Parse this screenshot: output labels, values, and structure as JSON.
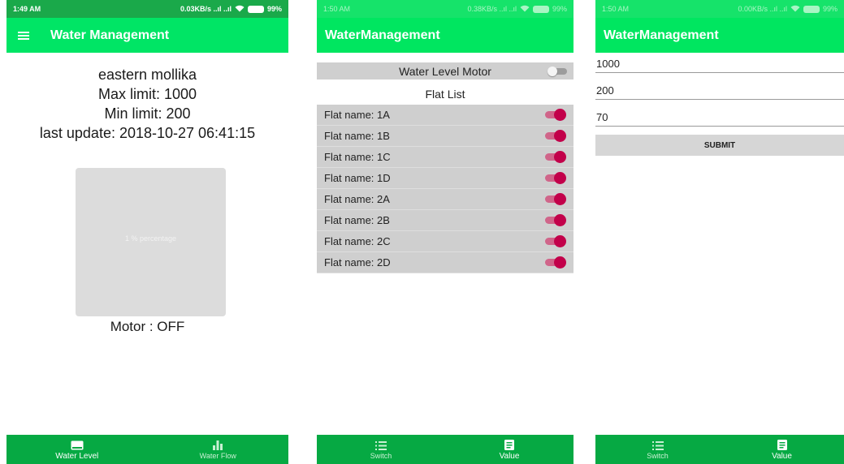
{
  "colors": {
    "status_bar_dark": "#1aa94a",
    "status_bar_light": "#16e36a",
    "app_bar": "#00e660",
    "bottom_nav": "#06a943",
    "toggle_on": "#c2004a",
    "row_gray": "#cfcfcf",
    "water": "#6ee3ee"
  },
  "screen1": {
    "status": {
      "time": "1:49 AM",
      "network": "0.03KB/s ..ıl ..ıl",
      "wifi_icon": "wifi-icon",
      "battery": "99%"
    },
    "app_bar": {
      "menu_icon": "hamburger-menu-icon",
      "title": "Water Management"
    },
    "tank_name": "eastern mollika",
    "max_limit": "Max limit: 1000",
    "min_limit": "Min limit: 200",
    "last_update": "last update: 2018-10-27 06:41:15",
    "tank_gauge": {
      "label": "1 % percentage",
      "level_percent": 1
    },
    "motor_status": "Motor :  OFF",
    "nav": [
      {
        "icon": "water-level-icon",
        "label": "Water Level",
        "active": true
      },
      {
        "icon": "bar-chart-icon",
        "label": "Water Flow",
        "active": false
      }
    ]
  },
  "screen2": {
    "status": {
      "time": "1:50 AM",
      "network": "0.38KB/s ..ıl ..ıl",
      "wifi_icon": "wifi-icon",
      "battery": "99%"
    },
    "app_bar": {
      "title": "WaterManagement"
    },
    "motor_toggle": {
      "label": "Water Level Motor",
      "on": false
    },
    "flat_list_title": "Flat List",
    "flats": [
      {
        "label": "Flat name: 1A",
        "on": true
      },
      {
        "label": "Flat name: 1B",
        "on": true
      },
      {
        "label": "Flat name: 1C",
        "on": true
      },
      {
        "label": "Flat name: 1D",
        "on": true
      },
      {
        "label": "Flat name: 2A",
        "on": true
      },
      {
        "label": "Flat name: 2B",
        "on": true
      },
      {
        "label": "Flat name: 2C",
        "on": true
      },
      {
        "label": "Flat name: 2D",
        "on": true
      }
    ],
    "nav": [
      {
        "icon": "list-icon",
        "label": "Switch",
        "active": false
      },
      {
        "icon": "document-icon",
        "label": "Value",
        "active": true
      }
    ]
  },
  "screen3": {
    "status": {
      "time": "1:50 AM",
      "network": "0.00KB/s ..ıl ..ıl",
      "wifi_icon": "wifi-icon",
      "battery": "99%"
    },
    "app_bar": {
      "title": "WaterManagement"
    },
    "max_value": "1000",
    "min_value": "200",
    "third_value": "70",
    "submit_label": "SUBMIT",
    "nav": [
      {
        "icon": "list-icon",
        "label": "Switch",
        "active": false
      },
      {
        "icon": "document-icon",
        "label": "Value",
        "active": true
      }
    ]
  }
}
